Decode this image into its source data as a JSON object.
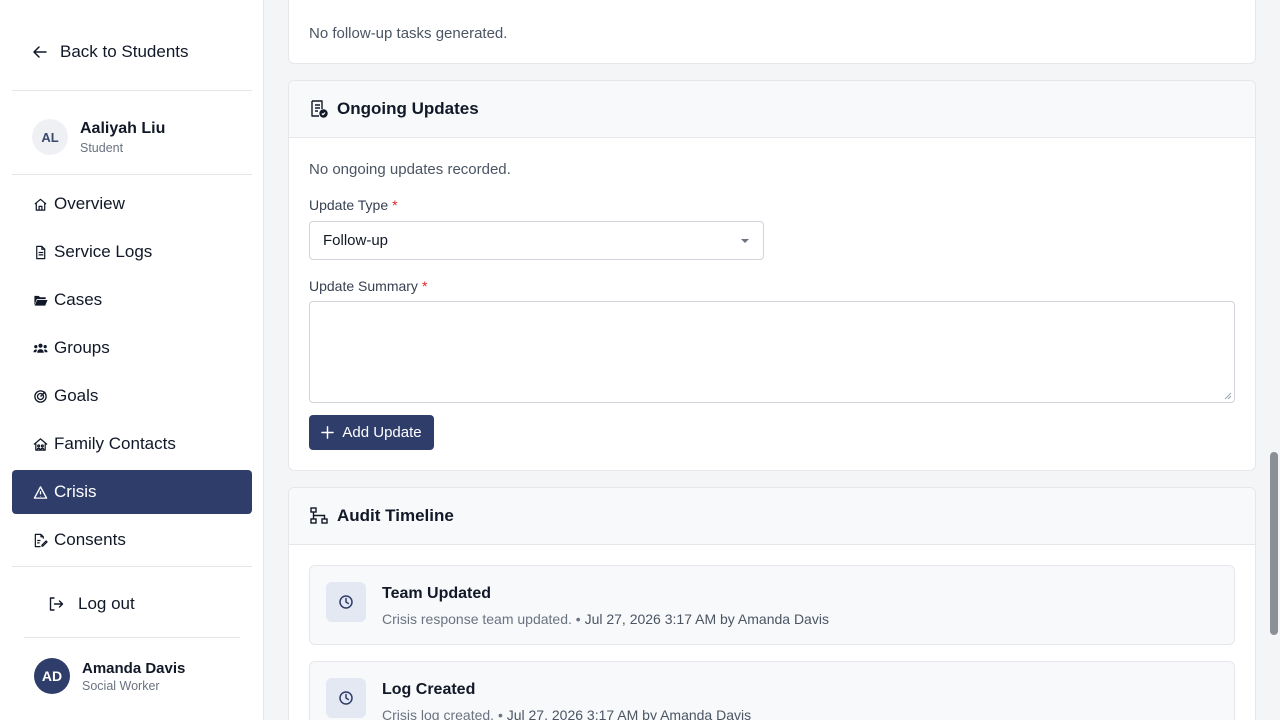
{
  "sidebar": {
    "back_label": "Back to Students",
    "student": {
      "initials": "AL",
      "name": "Aaliyah Liu",
      "role": "Student"
    },
    "nav": [
      {
        "label": "Overview",
        "icon": "home-icon"
      },
      {
        "label": "Service Logs",
        "icon": "document-icon"
      },
      {
        "label": "Cases",
        "icon": "folder-open-icon"
      },
      {
        "label": "Groups",
        "icon": "users-icon"
      },
      {
        "label": "Goals",
        "icon": "target-icon"
      },
      {
        "label": "Family Contacts",
        "icon": "family-home-icon"
      },
      {
        "label": "Crisis",
        "icon": "warning-icon",
        "active": true
      },
      {
        "label": "Consents",
        "icon": "signed-document-icon"
      }
    ],
    "logout_label": "Log out",
    "user": {
      "initials": "AD",
      "name": "Amanda Davis",
      "role": "Social Worker"
    }
  },
  "followup": {
    "empty_text": "No follow-up tasks generated."
  },
  "ongoing": {
    "title": "Ongoing Updates",
    "empty_text": "No ongoing updates recorded.",
    "type_label": "Update Type",
    "type_value": "Follow-up",
    "summary_label": "Update Summary",
    "required_mark": "*",
    "add_label": "Add Update"
  },
  "audit": {
    "title": "Audit Timeline",
    "entries": [
      {
        "title": "Team Updated",
        "desc": "Crisis response team updated.",
        "sep": "•",
        "date": "Jul 27, 2026 3:17 AM",
        "by": "by Amanda Davis"
      },
      {
        "title": "Log Created",
        "desc": "Crisis log created.",
        "sep": "•",
        "date": "Jul 27, 2026 3:17 AM",
        "by": "by Amanda Davis"
      }
    ]
  },
  "colors": {
    "primary": "#2f3d6b",
    "required": "#dc2626",
    "entry_icon_bg": "#e3e8f3"
  }
}
